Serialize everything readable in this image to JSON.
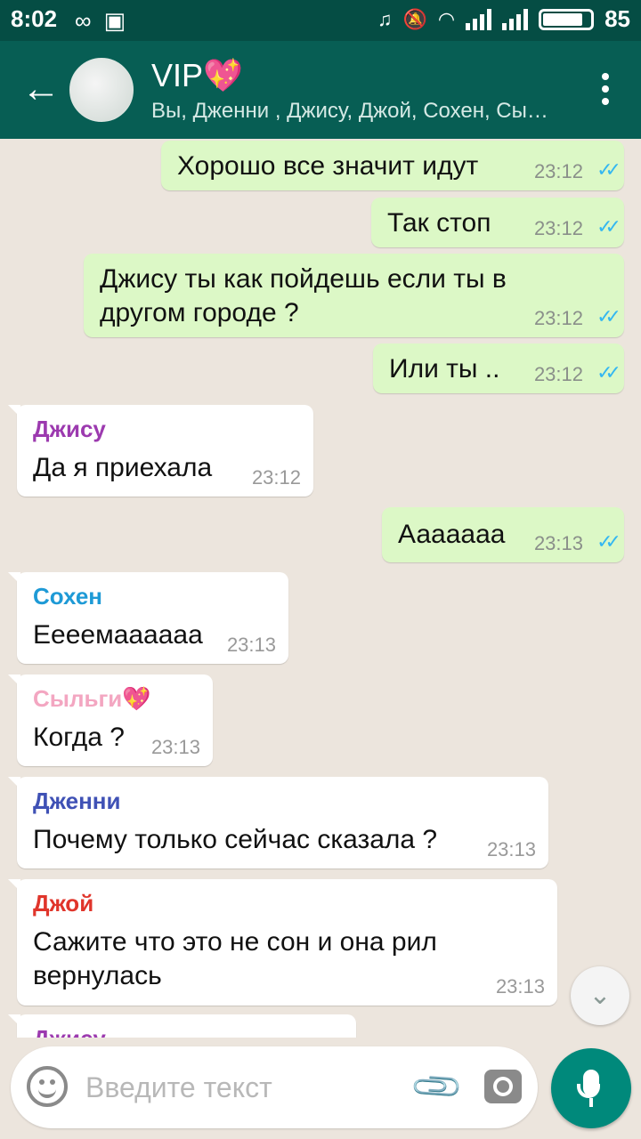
{
  "status_bar": {
    "time": "8:02",
    "battery": "85",
    "battery_level": 0.85
  },
  "header": {
    "title": "VIP💖",
    "subtitle": "Вы, Дженни , Джису, Джой, Сохен, Сыльги💖"
  },
  "messages": [
    {
      "dir": "out",
      "text": "Хорошо все значит идут",
      "time": "23:12"
    },
    {
      "dir": "out",
      "text": "Так стоп",
      "time": "23:12"
    },
    {
      "dir": "out",
      "text": "Джису ты как пойдешь если ты в другом городе ?",
      "time": "23:12"
    },
    {
      "dir": "out",
      "text": "Или ты ..",
      "time": "23:12"
    },
    {
      "dir": "in",
      "sender": "Джису",
      "sender_color": "#9c3aaf",
      "text": "Да я приехала",
      "time": "23:12"
    },
    {
      "dir": "out",
      "text": "Ааааааа",
      "time": "23:13"
    },
    {
      "dir": "in",
      "sender": "Сохен",
      "sender_color": "#1e9ad6",
      "text": "Еееемааааaа",
      "time": "23:13"
    },
    {
      "dir": "in",
      "sender": "Сыльги💖",
      "sender_color": "#f3a6c1",
      "text": "Когда ?",
      "time": "23:13"
    },
    {
      "dir": "in",
      "sender": "Дженни",
      "sender_color": "#3f51b5",
      "text": "Почему только сейчас сказала ?",
      "time": "23:13"
    },
    {
      "dir": "in",
      "sender": "Джой",
      "sender_color": "#e0352b",
      "text": "Сажите что это не сон и она рил вернулась",
      "time": "23:13"
    },
    {
      "dir": "in",
      "sender": "Джису",
      "sender_color": "#9c3aaf",
      "text": "",
      "time": ""
    }
  ],
  "composer": {
    "placeholder": "Введите текст"
  },
  "icons": [
    "back-arrow-icon",
    "more-vert-icon",
    "emoji-icon",
    "attach-icon",
    "camera-icon",
    "mic-icon",
    "chevron-down-icon",
    "read-ticks-icon"
  ]
}
